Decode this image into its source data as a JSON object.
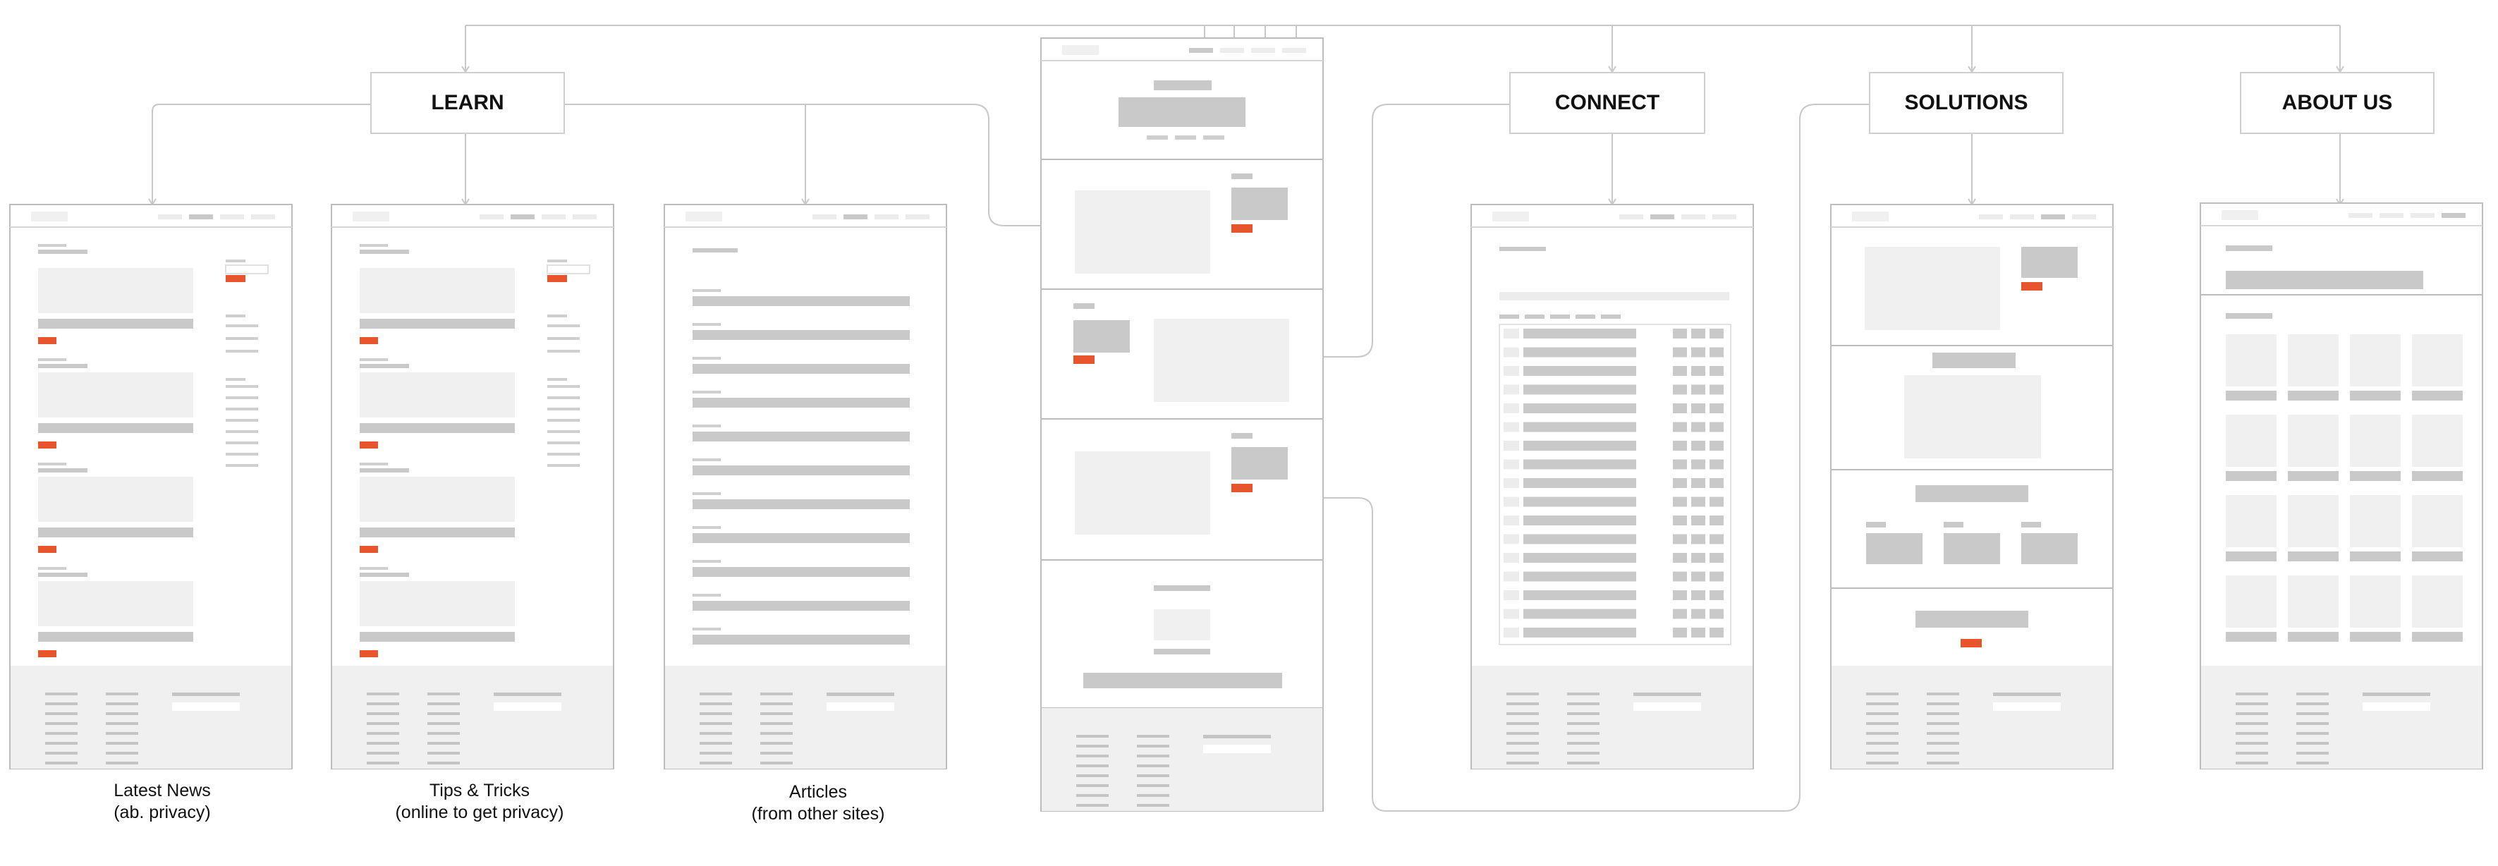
{
  "sections": {
    "learn": "LEARN",
    "connect": "CONNECT",
    "solutions": "SOLUTIONS",
    "about": "ABOUT US"
  },
  "captions": {
    "latest_news": {
      "line1": "Latest News",
      "line2": "(ab. privacy)"
    },
    "tips": {
      "line1": "Tips & Tricks",
      "line2": "(online to get privacy)"
    },
    "articles": {
      "line1": "Articles",
      "line2": "(from other sites)"
    }
  },
  "colors": {
    "line": "#c8c8c8",
    "frame_border": "#bdbdbd",
    "block_light": "#f0f0f0",
    "block_dark": "#c9c9c9",
    "accent": "#e8552d",
    "footer": "#f0f0f0"
  }
}
